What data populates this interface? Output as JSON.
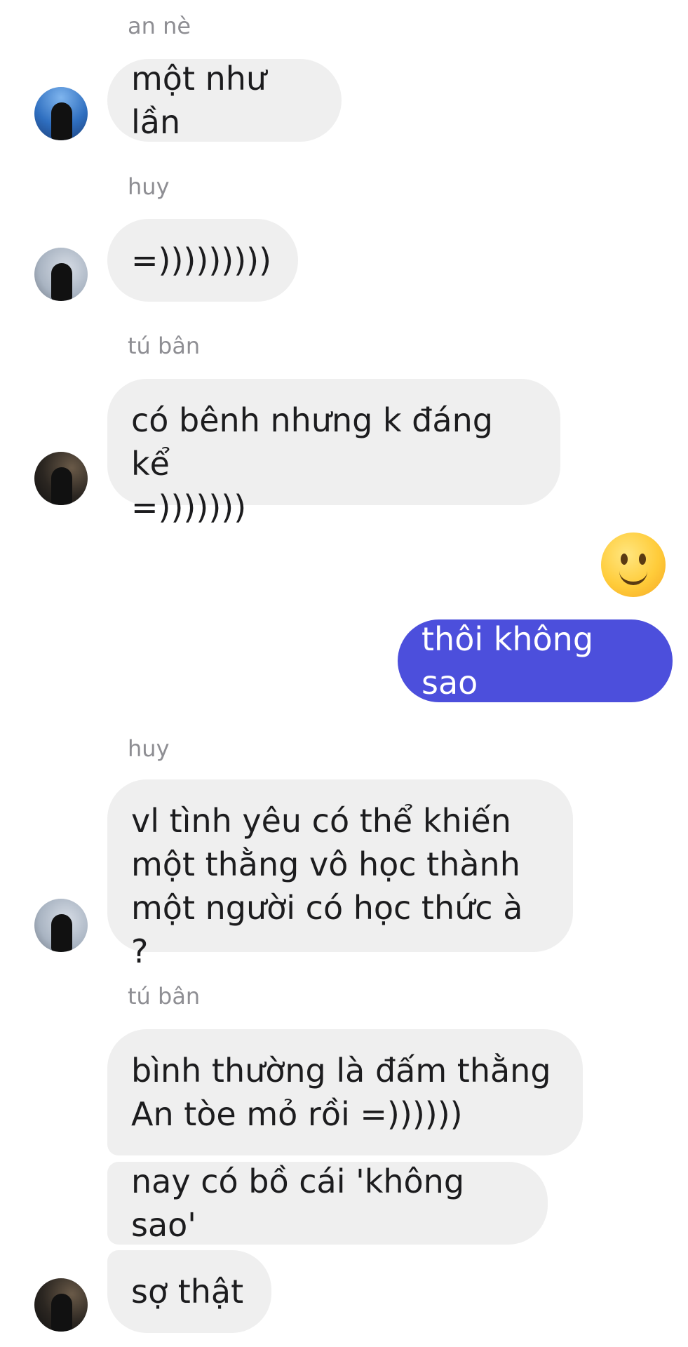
{
  "messages": [
    {
      "sender": "an nè",
      "text": "một như lần"
    },
    {
      "sender": "huy",
      "text": "=)))))))))"
    },
    {
      "sender": "tú bân",
      "text": "có bênh nhưng k đáng kể\n=)))))))"
    },
    {
      "emoji": "🙂",
      "text": "thôi không sao"
    },
    {
      "sender": "huy",
      "text": "vl tình yêu có thể khiến\nmột thằng vô học thành\nmột người có học thức à ?"
    },
    {
      "sender": "tú bân",
      "texts": [
        "bình thường là đấm thằng\nAn tòe mỏ rồi =))))))",
        "nay có bồ cái 'không sao'",
        "sợ thật"
      ]
    }
  ],
  "colors": {
    "incoming_bubble": "#efefef",
    "outgoing_bubble": "#4c4fdc",
    "sender_label": "#8e8e93"
  },
  "icons": {
    "reaction_emoji": "slightly-smiling-face-icon"
  }
}
